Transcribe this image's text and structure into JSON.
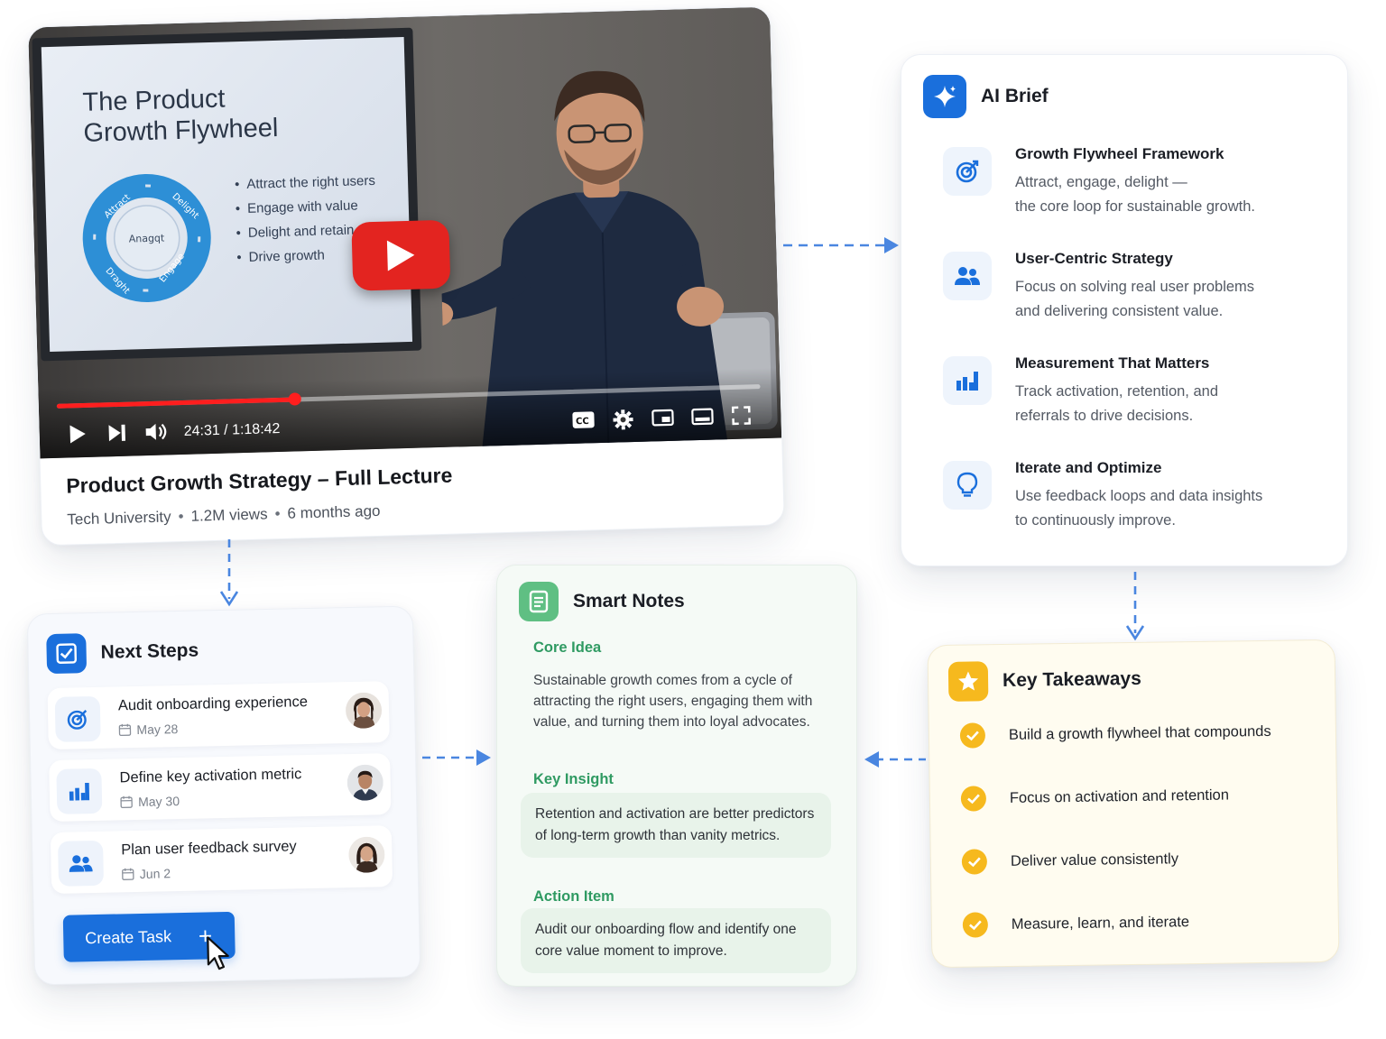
{
  "video": {
    "slide_title_line1": "The Product",
    "slide_title_line2": "Growth Flywheel",
    "flywheel_labels": [
      "Attract",
      "Anagqt",
      "Draght",
      "Engage",
      "Delight"
    ],
    "slide_bullets": [
      "Attract the right users",
      "Engage with value",
      "Delight and retain",
      "Drive growth"
    ],
    "time_display": "24:31 / 1:18:42",
    "progress": 0.338,
    "title": "Product Growth Strategy – Full Lecture",
    "channel": "Tech University",
    "views": "1.2M views",
    "age": "6 months ago",
    "icons": [
      "play-icon",
      "next-icon",
      "volume-icon",
      "captions-icon",
      "settings-icon",
      "miniplayer-icon",
      "theater-icon",
      "fullscreen-icon"
    ]
  },
  "brief": {
    "title": "AI Brief",
    "items": [
      {
        "icon": "target-icon",
        "title": "Growth Flywheel Framework",
        "desc": "Attract, engage, delight —\nthe core loop for sustainable growth."
      },
      {
        "icon": "users-icon",
        "title": "User-Centric Strategy",
        "desc": "Focus on solving real user problems\nand delivering consistent value."
      },
      {
        "icon": "bar-chart-icon",
        "title": "Measurement That Matters",
        "desc": "Track activation, retention, and\nreferrals to drive decisions."
      },
      {
        "icon": "lightbulb-icon",
        "title": "Iterate and Optimize",
        "desc": "Use feedback loops and data insights\nto continuously improve."
      }
    ]
  },
  "steps": {
    "title": "Next Steps",
    "items": [
      {
        "icon": "target-icon",
        "label": "Audit onboarding experience",
        "date": "May 28"
      },
      {
        "icon": "bar-chart-icon",
        "label": "Define key activation metric",
        "date": "May 30"
      },
      {
        "icon": "users-icon",
        "label": "Plan user feedback survey",
        "date": "Jun 2"
      }
    ],
    "create_label": "Create Task",
    "create_plus": "+"
  },
  "notes": {
    "title": "Smart Notes",
    "core_title": "Core Idea",
    "core_text": "Sustainable growth comes from a cycle of attracting the right users, engaging them with value, and turning them into loyal advocates.",
    "insight_title": "Key Insight",
    "insight_text": "Retention and activation are better predictors of long-term growth than vanity metrics.",
    "action_title": "Action Item",
    "action_text": "Audit our onboarding flow and identify one core value moment to improve."
  },
  "takeaways": {
    "title": "Key Takeaways",
    "items": [
      "Build a growth flywheel that compounds",
      "Focus on activation and retention",
      "Deliver value consistently",
      "Measure, learn, and iterate"
    ]
  },
  "colors": {
    "accent_blue": "#1a6fdc",
    "youtube_red": "#e32420",
    "notes_green": "#2f9a62",
    "takeaway_yellow": "#f6b91e",
    "connector_blue": "#4a86e0"
  }
}
